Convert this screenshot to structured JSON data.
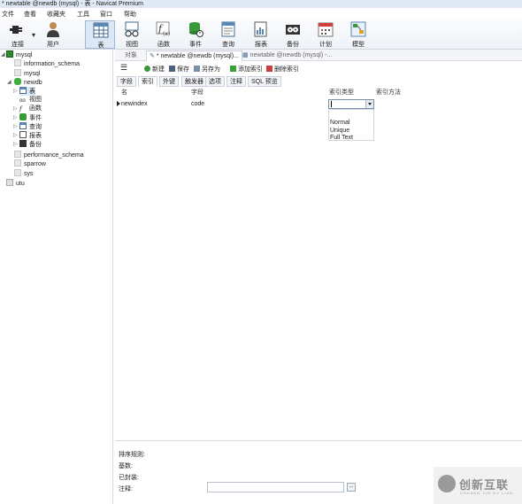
{
  "window": {
    "title": "* newtable @newdb (mysql) - 表 - Navicat Premium"
  },
  "menu": [
    "文件",
    "查看",
    "收藏夹",
    "工具",
    "窗口",
    "帮助"
  ],
  "toolbar": {
    "connect": "连接",
    "user": "用户",
    "table": "表",
    "view": "视图",
    "function": "函数",
    "event": "事件",
    "query": "查询",
    "report": "报表",
    "backup": "备份",
    "schedule": "计划",
    "model": "模型"
  },
  "tree": {
    "mysql": "mysql",
    "information_schema": "information_schema",
    "mysql_db": "mysql",
    "newdb": "newdb",
    "tables": "表",
    "views": "视图",
    "functions": "函数",
    "events": "事件",
    "queries": "查询",
    "reports": "报表",
    "backups": "备份",
    "performance_schema": "performance_schema",
    "sparrow": "sparrow",
    "sys": "sys",
    "utu": "utu"
  },
  "object_tabs": {
    "objects": "对象",
    "tab1": "* newtable @newdb (mysql)...",
    "tab2": "newtable @newdb (mysql) -..."
  },
  "actions": {
    "new": "新建",
    "save": "保存",
    "save_as": "另存为",
    "add_index": "添加索引",
    "delete_index": "删除索引"
  },
  "subtabs": [
    "字段",
    "索引",
    "外键",
    "触发器",
    "选项",
    "注释",
    "SQL 预览"
  ],
  "index_grid": {
    "headers": [
      "名",
      "字段",
      "索引类型",
      "索引方法"
    ],
    "rows": [
      {
        "name": "newindex",
        "field": "code",
        "type": ""
      }
    ]
  },
  "index_type_options": [
    "Normal",
    "Unique",
    "Full Text"
  ],
  "properties": {
    "sort_rule": "排序规则:",
    "base": "基数:",
    "packed": "已封装:",
    "comment": "注释:",
    "comment_value": "",
    "browse_button": "..."
  },
  "watermark": {
    "text": "创新互联",
    "sub": "CHUANG XIN HU LIAN"
  },
  "colors": {
    "toolbar_bg": "#eef2f7",
    "selection": "#dce8f5",
    "border": "#d7dce2"
  }
}
